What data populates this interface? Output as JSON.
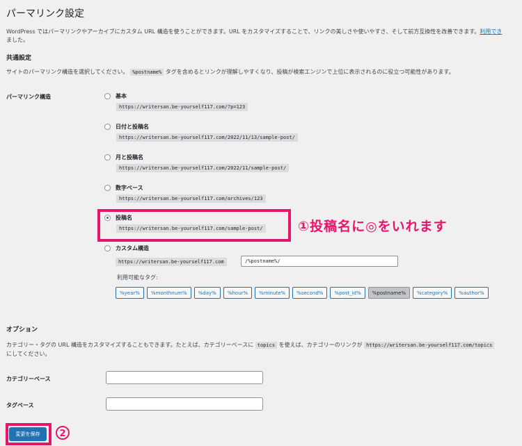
{
  "page_title": "パーマリンク設定",
  "intro": {
    "text_line1": "WordPress ではパーマリンクやアーカイブにカスタム URL 構造を使うことができます。URL をカスタマイズすることで、リンクの美しさや使いやすさ、そして前方互換性を改善できます。",
    "link": "利用でき",
    "text_line2": "ました。"
  },
  "common": {
    "heading": "共通設定",
    "desc_before": "サイトのパーマリンク構造を選択してください。",
    "desc_code": "%postname%",
    "desc_after": "タグを含めるとリンクが理解しやすくなり、投稿が検索エンジンで上位に表示されるのに役立つ可能性があります。"
  },
  "permalink": {
    "label": "パーマリンク構造",
    "options": [
      {
        "label": "基本",
        "url": "https://writersan.be-yourself117.com/?p=123",
        "checked": false
      },
      {
        "label": "日付と投稿名",
        "url": "https://writersan.be-yourself117.com/2022/11/13/sample-post/",
        "checked": false
      },
      {
        "label": "月と投稿名",
        "url": "https://writersan.be-yourself117.com/2022/11/sample-post/",
        "checked": false
      },
      {
        "label": "数字ベース",
        "url": "https://writersan.be-yourself117.com/archives/123",
        "checked": false
      },
      {
        "label": "投稿名",
        "url": "https://writersan.be-yourself117.com/sample-post/",
        "checked": true
      },
      {
        "label": "カスタム構造",
        "checked": false
      }
    ],
    "custom_prefix": "https://writersan.be-yourself117.com",
    "custom_value": "/%postname%/",
    "tags_label": "利用可能なタグ:",
    "tags": [
      "%year%",
      "%monthnum%",
      "%day%",
      "%hour%",
      "%minute%",
      "%second%",
      "%post_id%",
      "%postname%",
      "%category%",
      "%author%"
    ],
    "active_tag": "%postname%"
  },
  "options": {
    "heading": "オプション",
    "desc_before": "カテゴリー・タグの URL 構造をカスタマイズすることもできます。たとえば、カテゴリーベースに",
    "desc_code1": "topics",
    "desc_mid": "を使えば、カテゴリーのリンクが",
    "desc_code2": "https://writersan.be-yourself117.com/topics",
    "desc_line2": "にしてください。",
    "category_base_label": "カテゴリーベース",
    "tag_base_label": "タグベース",
    "category_base_value": "",
    "tag_base_value": ""
  },
  "save_label": "変更を保存",
  "annotations": {
    "note1": "①投稿名に◎をいれます",
    "note2": "2"
  },
  "colors": {
    "accent": "#2271b1",
    "highlight": "#e4156b",
    "background": "#f0f0f1"
  }
}
